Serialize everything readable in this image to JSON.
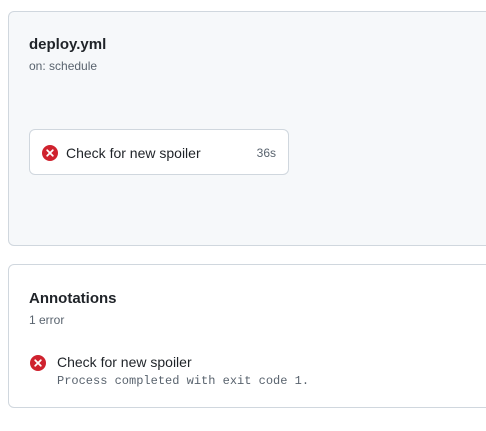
{
  "workflow": {
    "file_name": "deploy.yml",
    "trigger": "on: schedule",
    "job": {
      "name": "Check for new spoiler",
      "duration": "36s",
      "status": "failure",
      "status_icon": "x-circle-fill-icon"
    }
  },
  "annotations": {
    "title": "Annotations",
    "count_text": "1 error",
    "items": [
      {
        "title": "Check for new spoiler",
        "message": "Process completed with exit code 1.",
        "level": "error",
        "icon": "x-circle-fill-icon"
      }
    ]
  },
  "colors": {
    "error": "#cf222e",
    "border": "#d0d7de",
    "muted_text": "#59636e",
    "canvas_subtle": "#f6f8fa"
  }
}
